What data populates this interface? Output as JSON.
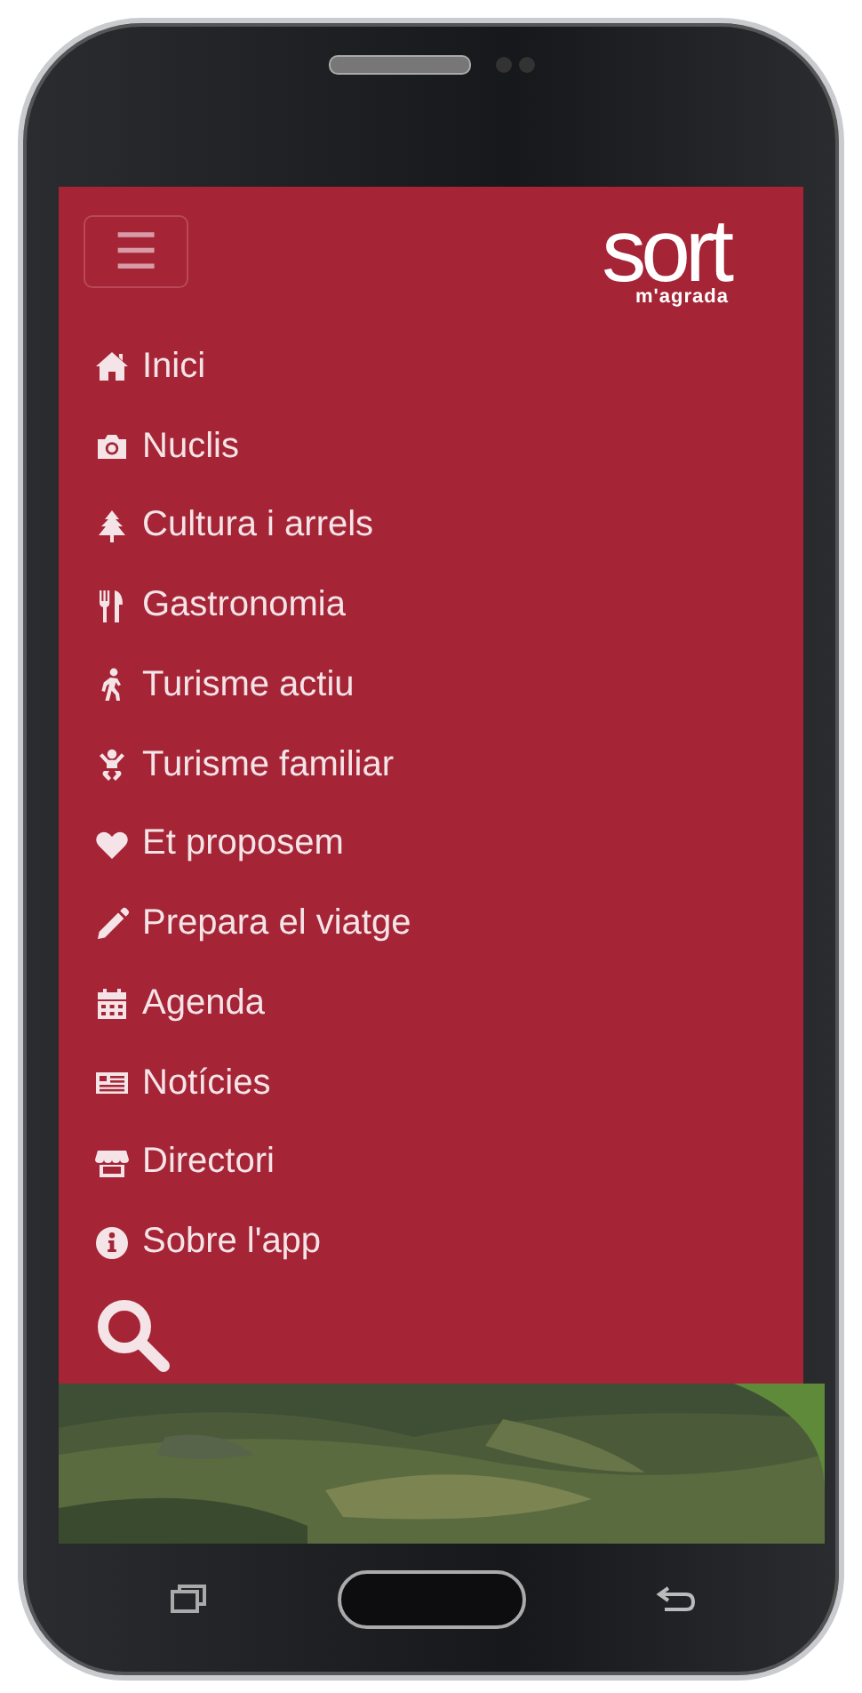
{
  "header": {
    "menu_button": "☰",
    "logo": {
      "wordmark": "sort",
      "tagline": "m'agrada"
    }
  },
  "menu": {
    "items": [
      {
        "label": "Inici"
      },
      {
        "label": "Nuclis"
      },
      {
        "label": "Cultura i arrels"
      },
      {
        "label": "Gastronomia"
      },
      {
        "label": "Turisme actiu"
      },
      {
        "label": "Turisme familiar"
      },
      {
        "label": "Et proposem"
      },
      {
        "label": "Prepara el viatge"
      },
      {
        "label": "Agenda"
      },
      {
        "label": "Notícies"
      },
      {
        "label": "Directori"
      },
      {
        "label": "Sobre l'app"
      }
    ]
  }
}
